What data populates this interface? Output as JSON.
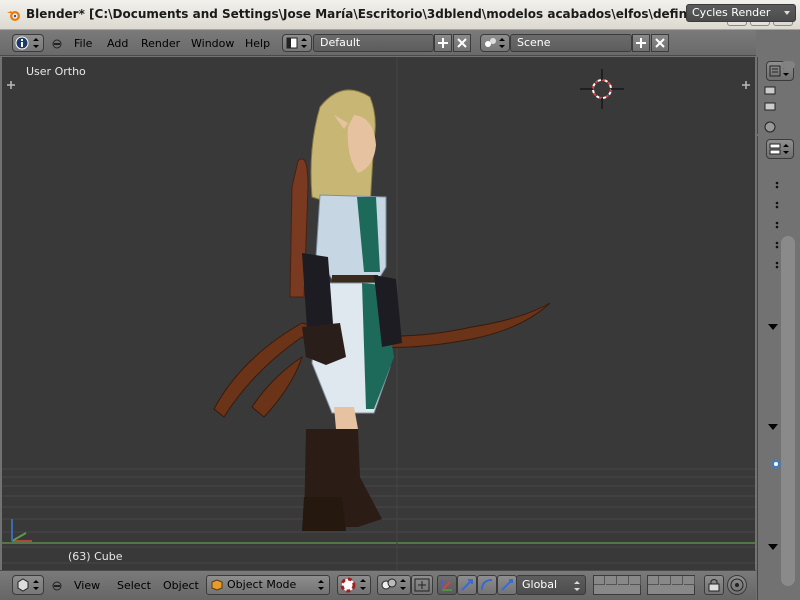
{
  "window": {
    "title": "Blender* [C:\\Documents and Settings\\Jose María\\Escritorio\\3dblend\\modelos acabados\\elfos\\definitivos\\solare…"
  },
  "info_header": {
    "menus": [
      "File",
      "Add",
      "Render",
      "Window",
      "Help"
    ],
    "screen_layout": "Default",
    "scene": "Scene",
    "render_engine": "Cycles Render"
  },
  "viewport": {
    "view_name": "User Ortho",
    "active_object": "(63) Cube"
  },
  "view3d_header": {
    "menus": [
      "View",
      "Select",
      "Object"
    ],
    "mode": "Object Mode",
    "transform_orientation": "Global"
  },
  "colors": {
    "viewport_bg": "#393939",
    "header_bg": "#727272",
    "grid_line": "#474747",
    "x_axis": "#b0483f",
    "y_axis": "#5a9a4a"
  },
  "icons": {
    "app": "blender-logo-icon",
    "editor_type": "info-icon",
    "view3d_editor": "cube-icon",
    "render_engine_arrow": "chevron-down-icon"
  }
}
